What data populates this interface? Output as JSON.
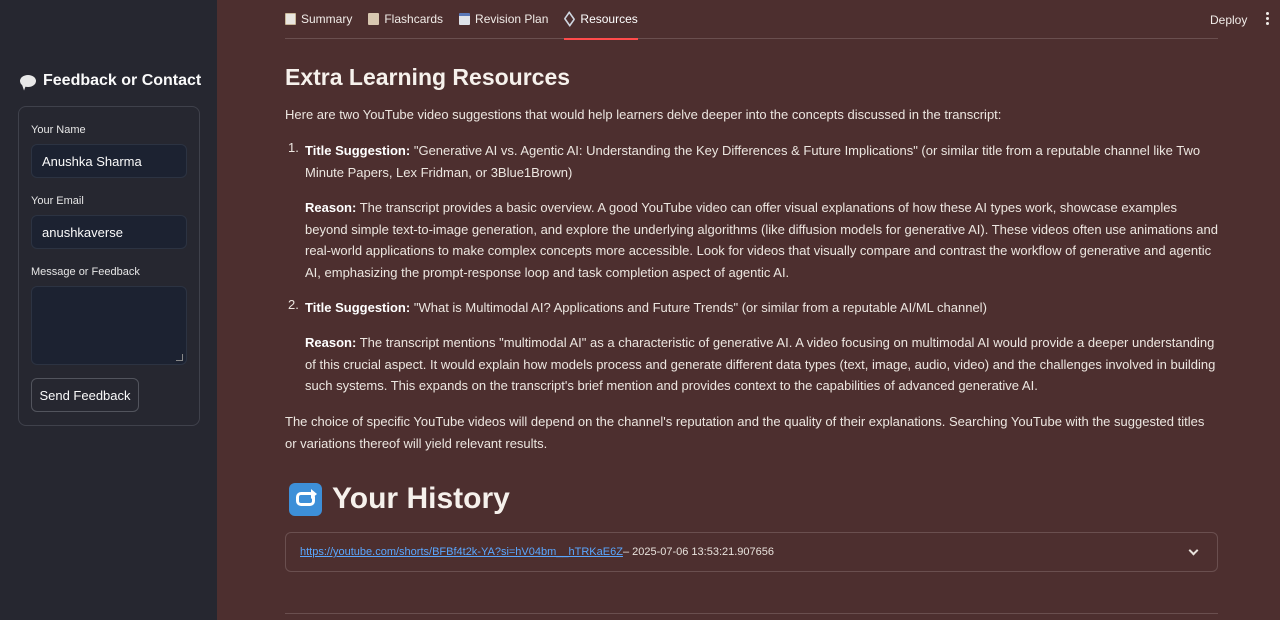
{
  "sidebar": {
    "title": "Feedback or Contact",
    "name_label": "Your Name",
    "name_value": "Anushka Sharma",
    "email_label": "Your Email",
    "email_value": "anushkaverse",
    "message_label": "Message or Feedback",
    "message_value": "",
    "send_button": "Send Feedback"
  },
  "tabs": [
    {
      "label": "Summary",
      "icon": "document-icon"
    },
    {
      "label": "Flashcards",
      "icon": "card-icon"
    },
    {
      "label": "Revision Plan",
      "icon": "calendar-icon"
    },
    {
      "label": "Resources",
      "icon": "link-icon",
      "active": true
    }
  ],
  "header": {
    "deploy": "Deploy"
  },
  "main": {
    "title": "Extra Learning Resources",
    "intro": "Here are two YouTube video suggestions that would help learners delve deeper into the concepts discussed in the transcript:",
    "items": [
      {
        "number": "1.",
        "title_label": "Title Suggestion:",
        "title_text": "\"Generative AI vs. Agentic AI: Understanding the Key Differences & Future Implications\" (or similar title from a reputable channel like Two Minute Papers, Lex Fridman, or 3Blue1Brown)",
        "reason_label": "Reason:",
        "reason_text": "The transcript provides a basic overview. A good YouTube video can offer visual explanations of how these AI types work, showcase examples beyond simple text-to-image generation, and explore the underlying algorithms (like diffusion models for generative AI). These videos often use animations and real-world applications to make complex concepts more accessible. Look for videos that visually compare and contrast the workflow of generative and agentic AI, emphasizing the prompt-response loop and task completion aspect of agentic AI."
      },
      {
        "number": "2.",
        "title_label": "Title Suggestion:",
        "title_text": "\"What is Multimodal AI? Applications and Future Trends\" (or similar from a reputable AI/ML channel)",
        "reason_label": "Reason:",
        "reason_text": "The transcript mentions \"multimodal AI\" as a characteristic of generative AI. A video focusing on multimodal AI would provide a deeper understanding of this crucial aspect. It would explain how models process and generate different data types (text, image, audio, video) and the challenges involved in building such systems. This expands on the transcript's brief mention and provides context to the capabilities of advanced generative AI."
      }
    ],
    "outro": "The choice of specific YouTube videos will depend on the channel's reputation and the quality of their explanations. Searching YouTube with the suggested titles or variations thereof will yield relevant results."
  },
  "history": {
    "title": "Your History",
    "entries": [
      {
        "url": "https://youtube.com/shorts/BFBf4t2k-YA?si=hV04bm__hTRKaE6Z",
        "timestamp": " – 2025-07-06 13:53:21.907656"
      }
    ]
  }
}
